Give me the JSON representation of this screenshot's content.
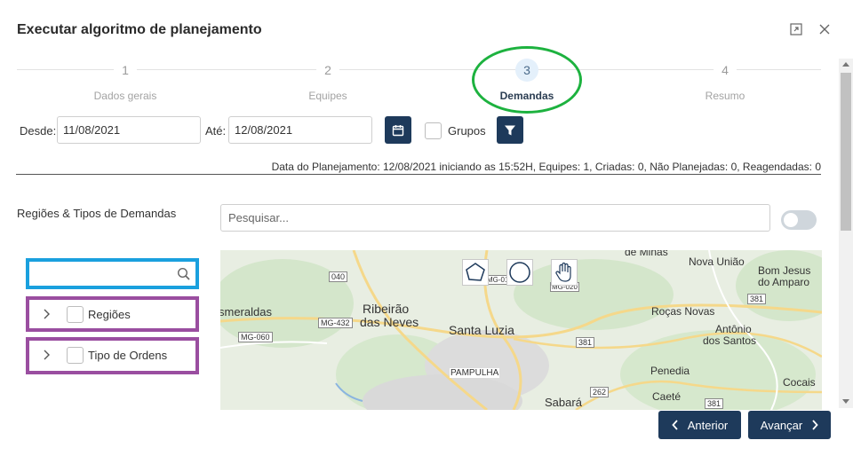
{
  "dialog": {
    "title": "Executar algoritmo de planejamento"
  },
  "steps": [
    {
      "number": "1",
      "label": "Dados gerais"
    },
    {
      "number": "2",
      "label": "Equipes"
    },
    {
      "number": "3",
      "label": "Demandas"
    },
    {
      "number": "4",
      "label": "Resumo"
    }
  ],
  "filters": {
    "from_label": "Desde:",
    "from_value": "11/08/2021",
    "to_label": "Até:",
    "to_value": "12/08/2021",
    "groups_label": "Grupos"
  },
  "info": "Data do Planejamento: 12/08/2021 iniciando as 15:52H, Equipes: 1, Criadas: 0, Não Planejadas: 0, Reagendadas: 0",
  "regions": {
    "title": "Regiões & Tipos de Demandas",
    "search_placeholder": "Pesquisar...",
    "tree": [
      {
        "label": "Regiões"
      },
      {
        "label": "Tipo de Ordens"
      }
    ]
  },
  "map": {
    "labels": [
      "smeraldas",
      "Ribeirão",
      "das Neves",
      "Santa Luzia",
      "PAMPULHA",
      "Sabará",
      "de Minas",
      "Nova União",
      "Bom Jesus",
      "do Amparo",
      "Roças Novas",
      "Antônio",
      "dos Santos",
      "Penedia",
      "Caeté",
      "Cocais"
    ],
    "road_labels": [
      "040",
      "MG-432",
      "MG-060",
      "381",
      "381",
      "262",
      "381",
      "MG-010",
      "MG-020"
    ]
  },
  "buttons": {
    "previous": "Anterior",
    "next": "Avançar"
  },
  "colors": {
    "primary": "#1e3a5b",
    "highlight_green": "#1db23f",
    "highlight_blue": "#1aa0de",
    "highlight_purple": "#9a4ea0"
  }
}
